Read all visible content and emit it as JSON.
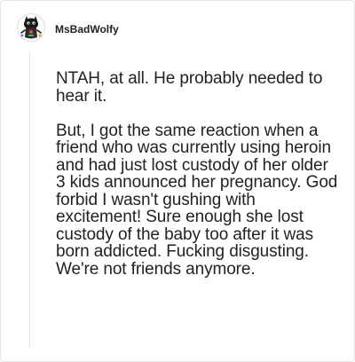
{
  "comment": {
    "username": "MsBadWolfy",
    "avatar_icon": "wolf-doodle-avatar-icon",
    "paragraphs": [
      "NTAH, at all. He probably needed to hear it.",
      "But, I got the same reaction when a friend who was currently using heroin and had just lost custody of her older 3 kids announced her pregnancy. God forbid I wasn't gushing with excitement! Sure enough she lost custody of the baby too after it was born addicted. Fucking disgusting. We're not friends anymore."
    ]
  }
}
